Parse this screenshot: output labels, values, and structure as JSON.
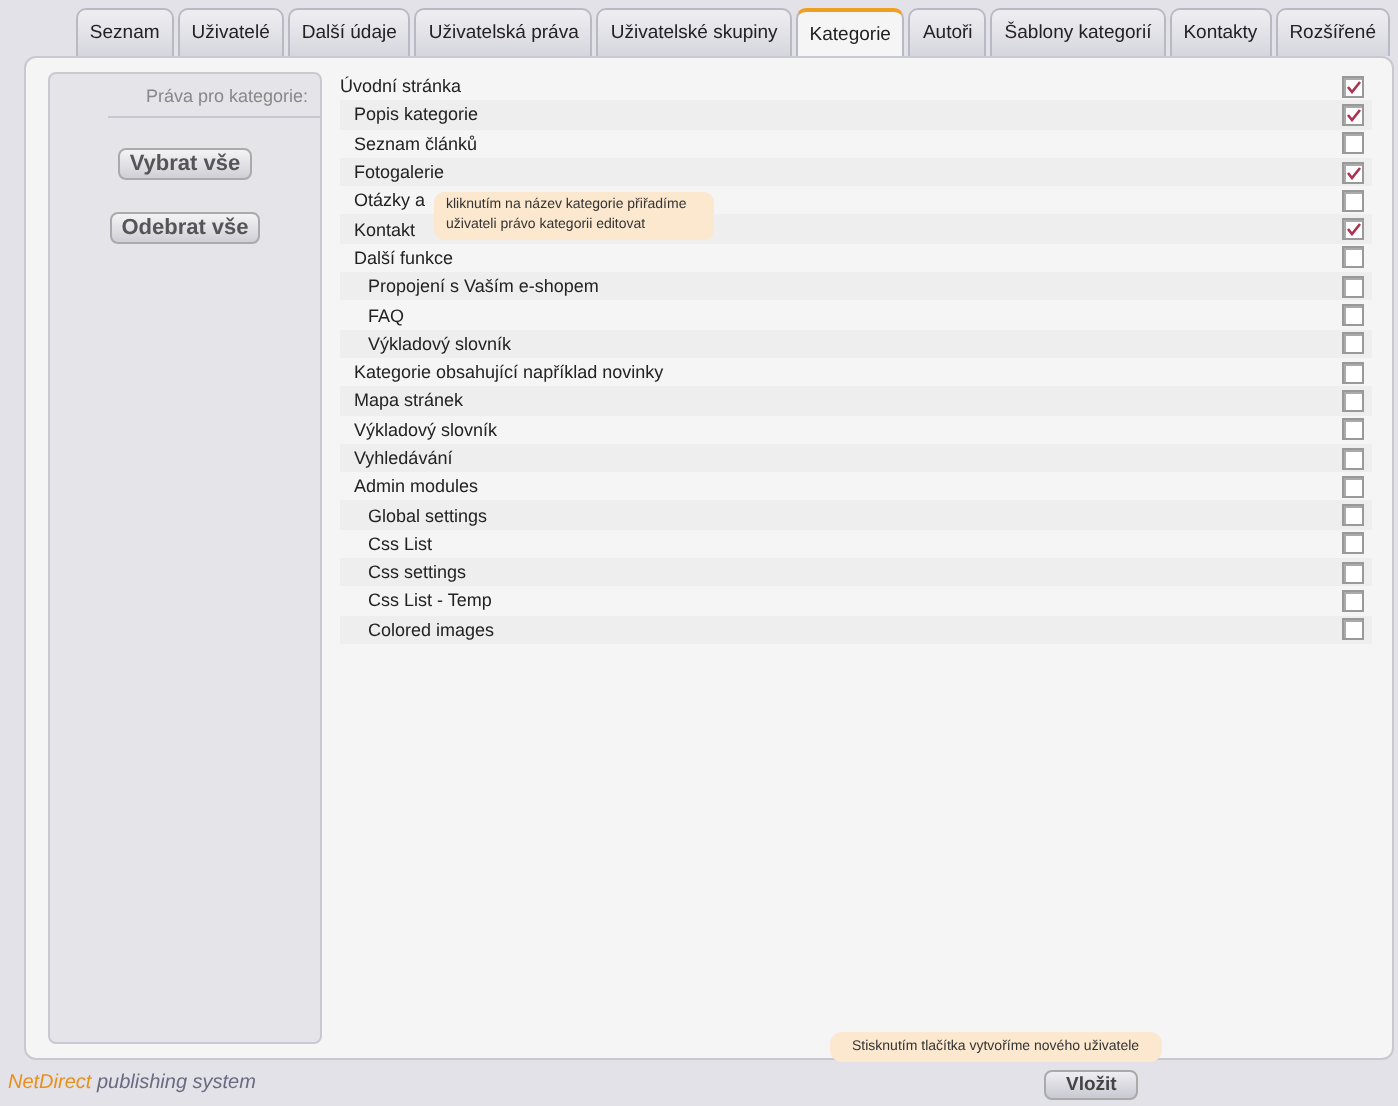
{
  "tabs": [
    {
      "label": "Seznam",
      "selected": false
    },
    {
      "label": "Uživatelé",
      "selected": false
    },
    {
      "label": "Další údaje",
      "selected": false
    },
    {
      "label": "Uživatelská práva",
      "selected": false
    },
    {
      "label": "Uživatelské skupiny",
      "selected": false
    },
    {
      "label": "Kategorie",
      "selected": true
    },
    {
      "label": "Autoři",
      "selected": false
    },
    {
      "label": "Šablony kategorií",
      "selected": false
    },
    {
      "label": "Kontakty",
      "selected": false
    },
    {
      "label": "Rozšířené",
      "selected": false
    }
  ],
  "sidebar": {
    "heading": "Práva pro kategorie:",
    "buttons": [
      "Vybrat vše",
      "Odebrat vše"
    ]
  },
  "categories": [
    {
      "name": "Úvodní stránka",
      "checked": true,
      "children": [
        {
          "name": "Popis kategorie",
          "checked": true
        },
        {
          "name": "Seznam článků",
          "checked": false
        },
        {
          "name": "Fotogalerie",
          "checked": true
        },
        {
          "name": "Otázky a",
          "checked": false
        },
        {
          "name": "Kontakt",
          "checked": true
        },
        {
          "name": "Další funkce",
          "checked": false,
          "children": [
            {
              "name": "Propojení s Vaším e-shopem",
              "checked": false
            },
            {
              "name": "FAQ",
              "checked": false
            },
            {
              "name": "Výkladový slovník",
              "checked": false
            }
          ]
        },
        {
          "name": "Kategorie obsahující například novinky",
          "checked": false
        },
        {
          "name": "Mapa stránek",
          "checked": false
        },
        {
          "name": "Výkladový slovník",
          "checked": false
        },
        {
          "name": "Vyhledávání",
          "checked": false
        },
        {
          "name": "Admin modules",
          "checked": false,
          "children": [
            {
              "name": "Global settings",
              "checked": false
            },
            {
              "name": "Css List",
              "checked": false
            },
            {
              "name": "Css settings",
              "checked": false
            },
            {
              "name": "Css List - Temp",
              "checked": false
            },
            {
              "name": "Colored images",
              "checked": false
            }
          ]
        }
      ]
    }
  ],
  "category_tooltip": "kliknutím na název kategorie přiřadíme uživateli právo kategorii editovat",
  "footer": {
    "brand": "NetDirect",
    "brand_suffix": "publishing system",
    "tooltip": "Stisknutím tlačítka vytvoříme nového uživatele",
    "button": "Vložit"
  }
}
